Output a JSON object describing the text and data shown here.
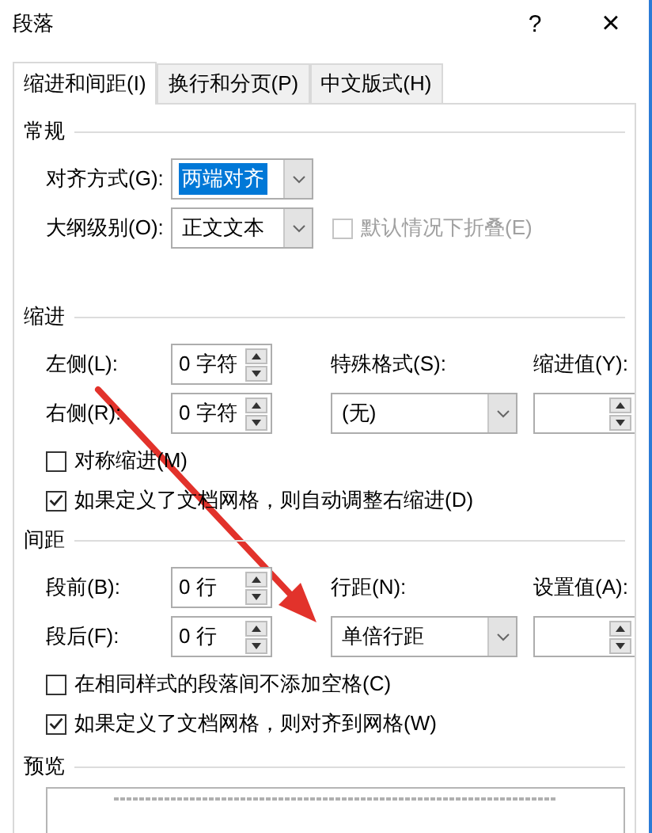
{
  "window": {
    "title": "段落",
    "help": "?",
    "close": "×"
  },
  "tabs": [
    {
      "label": "缩进和间距(I)",
      "selected": true
    },
    {
      "label": "换行和分页(P)",
      "selected": false
    },
    {
      "label": "中文版式(H)",
      "selected": false
    }
  ],
  "general": {
    "title": "常规",
    "alignment": {
      "label": "对齐方式(G):",
      "value": "两端对齐",
      "highlighted": true
    },
    "outline_level": {
      "label": "大纲级别(O):",
      "value": "正文文本",
      "highlighted": false
    },
    "collapse": {
      "label": "默认情况下折叠(E)",
      "checked": false,
      "disabled": true
    }
  },
  "indent": {
    "title": "缩进",
    "left": {
      "label": "左侧(L):",
      "value": "0 字符"
    },
    "right": {
      "label": "右侧(R):",
      "value": "0 字符"
    },
    "special": {
      "label": "特殊格式(S):",
      "value": "(无)"
    },
    "by": {
      "label": "缩进值(Y):"
    },
    "checks": [
      {
        "label": "对称缩进(M)",
        "checked": false,
        "disabled": false
      },
      {
        "label": "如果定义了文档网格，则自动调整右缩进(D)",
        "checked": true,
        "disabled": false
      }
    ]
  },
  "spacing": {
    "title": "间距",
    "before": {
      "label": "段前(B):",
      "value": "0 行"
    },
    "after": {
      "label": "段后(F):",
      "value": "0 行"
    },
    "line_spacing": {
      "label": "行距(N):",
      "value": "单倍行距"
    },
    "at": {
      "label": "设置值(A):"
    },
    "checks": [
      {
        "label": "在相同样式的段落间不添加空格(C)",
        "checked": false,
        "disabled": false
      },
      {
        "label": "如果定义了文档网格，则对齐到网格(W)",
        "checked": true,
        "disabled": false
      }
    ]
  },
  "preview": {
    "title": "预览"
  }
}
